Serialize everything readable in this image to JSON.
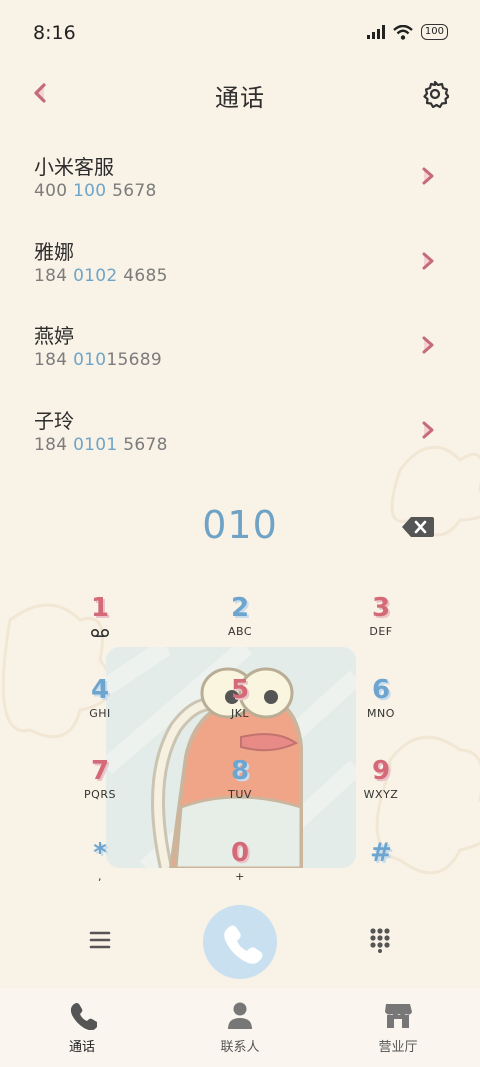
{
  "status": {
    "time": "8:16",
    "battery": "100"
  },
  "header": {
    "title": "通话"
  },
  "contacts": [
    {
      "name": "小米客服",
      "num_pre": "400 ",
      "num_hl": "100",
      "num_post": " 5678"
    },
    {
      "name": "雅娜",
      "num_pre": "184 ",
      "num_hl": "0102",
      "num_post": " 4685"
    },
    {
      "name": "燕婷",
      "num_pre": "184 ",
      "num_hl": "010",
      "num_post": "15689"
    },
    {
      "name": "子玲",
      "num_pre": "184 ",
      "num_hl": "0101",
      "num_post": " 5678"
    }
  ],
  "dial": {
    "input": "010"
  },
  "keypad": [
    {
      "digit": "1",
      "letters": ""
    },
    {
      "digit": "2",
      "letters": "ABC"
    },
    {
      "digit": "3",
      "letters": "DEF"
    },
    {
      "digit": "4",
      "letters": "GHI"
    },
    {
      "digit": "5",
      "letters": "JKL"
    },
    {
      "digit": "6",
      "letters": "MNO"
    },
    {
      "digit": "7",
      "letters": "PQRS"
    },
    {
      "digit": "8",
      "letters": "TUV"
    },
    {
      "digit": "9",
      "letters": "WXYZ"
    },
    {
      "digit": "*",
      "letters": ","
    },
    {
      "digit": "0",
      "letters": "+"
    },
    {
      "digit": "#",
      "letters": ""
    }
  ],
  "tabs": [
    {
      "label": "通话",
      "icon": "phone-icon"
    },
    {
      "label": "联系人",
      "icon": "person-icon"
    },
    {
      "label": "营业厅",
      "icon": "store-icon"
    }
  ],
  "colors": {
    "background": "#f9f2e6",
    "accent_blue": "#6ea5c8",
    "accent_red": "#d46a78",
    "call_button": "#c9e0f0"
  }
}
